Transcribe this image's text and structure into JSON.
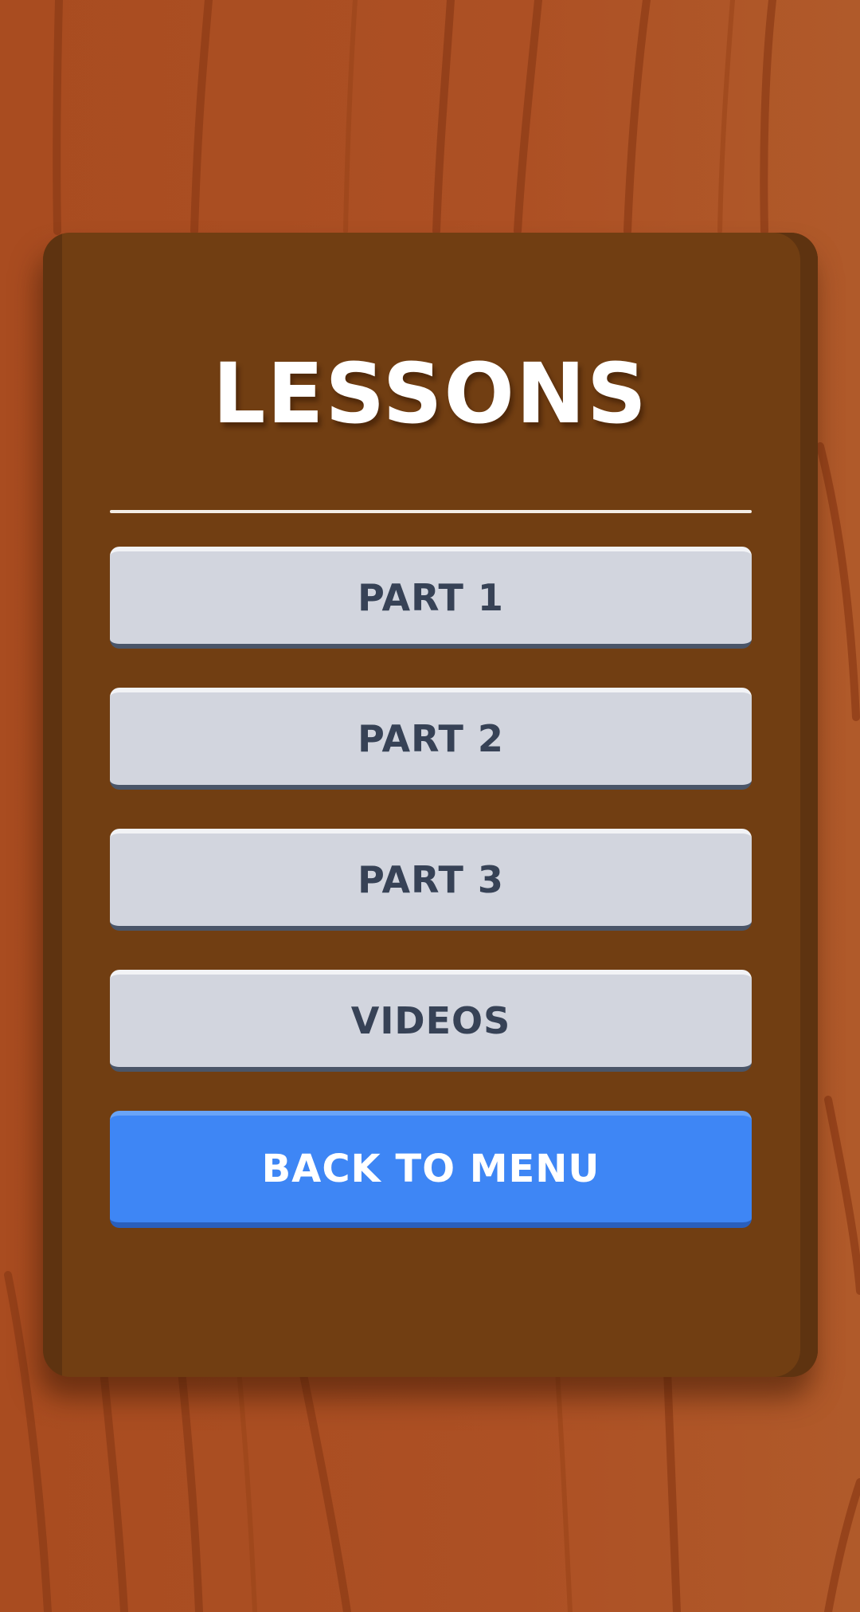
{
  "screen": {
    "title": "LESSONS",
    "buttons": [
      {
        "label": "PART 1"
      },
      {
        "label": "PART 2"
      },
      {
        "label": "PART 3"
      },
      {
        "label": "VIDEOS"
      }
    ],
    "back_label": "BACK TO MENU"
  },
  "colors": {
    "background_wood": "#aa4e22",
    "panel": "#713e12",
    "panel_edge": "#5e3310",
    "button_fill": "#d2d5de",
    "button_text": "#374256",
    "back_button_fill": "#3e86f5",
    "title_text": "#ffffff"
  }
}
